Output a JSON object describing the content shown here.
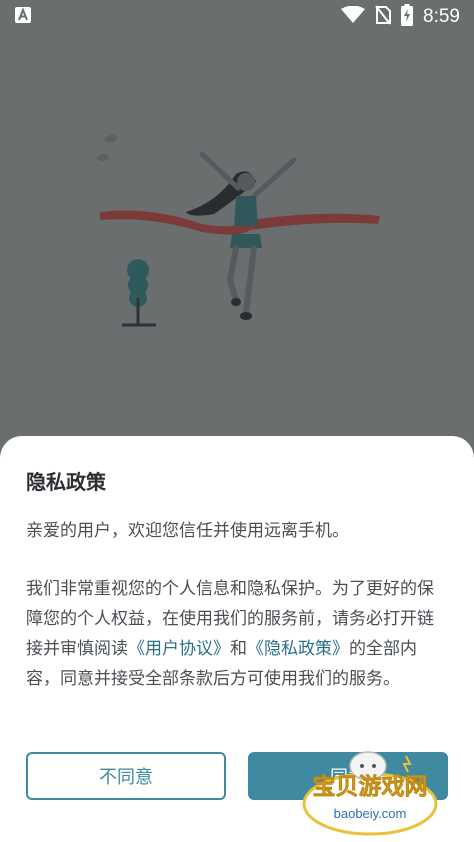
{
  "status_bar": {
    "time": "8:59",
    "icons": [
      "a-notification-icon",
      "wifi-icon",
      "no-sim-icon",
      "battery-charging-icon"
    ]
  },
  "dialog": {
    "title": "隐私政策",
    "paragraph1": "亲爱的用户，欢迎您信任并使用远离手机。",
    "paragraph2_part1": "我们非常重视您的个人信息和隐私保护。为了更好的保障您的个人权益，在使用我们的服务前，请务必打开链接并审慎阅读",
    "link_user_agreement": "《用户协议》",
    "paragraph2_and": "和",
    "link_privacy_policy": "《隐私政策》",
    "paragraph2_part2": "的全部内容，同意并接受全部条款后方可使用我们的服务。",
    "disagree_label": "不同意",
    "agree_label": "同意"
  },
  "watermark": {
    "title": "宝贝游戏网",
    "url": "baobeiy.com"
  },
  "colors": {
    "accent": "#3f8aa0",
    "overlay": "#6b6e6f",
    "link": "#2a6f8a"
  }
}
